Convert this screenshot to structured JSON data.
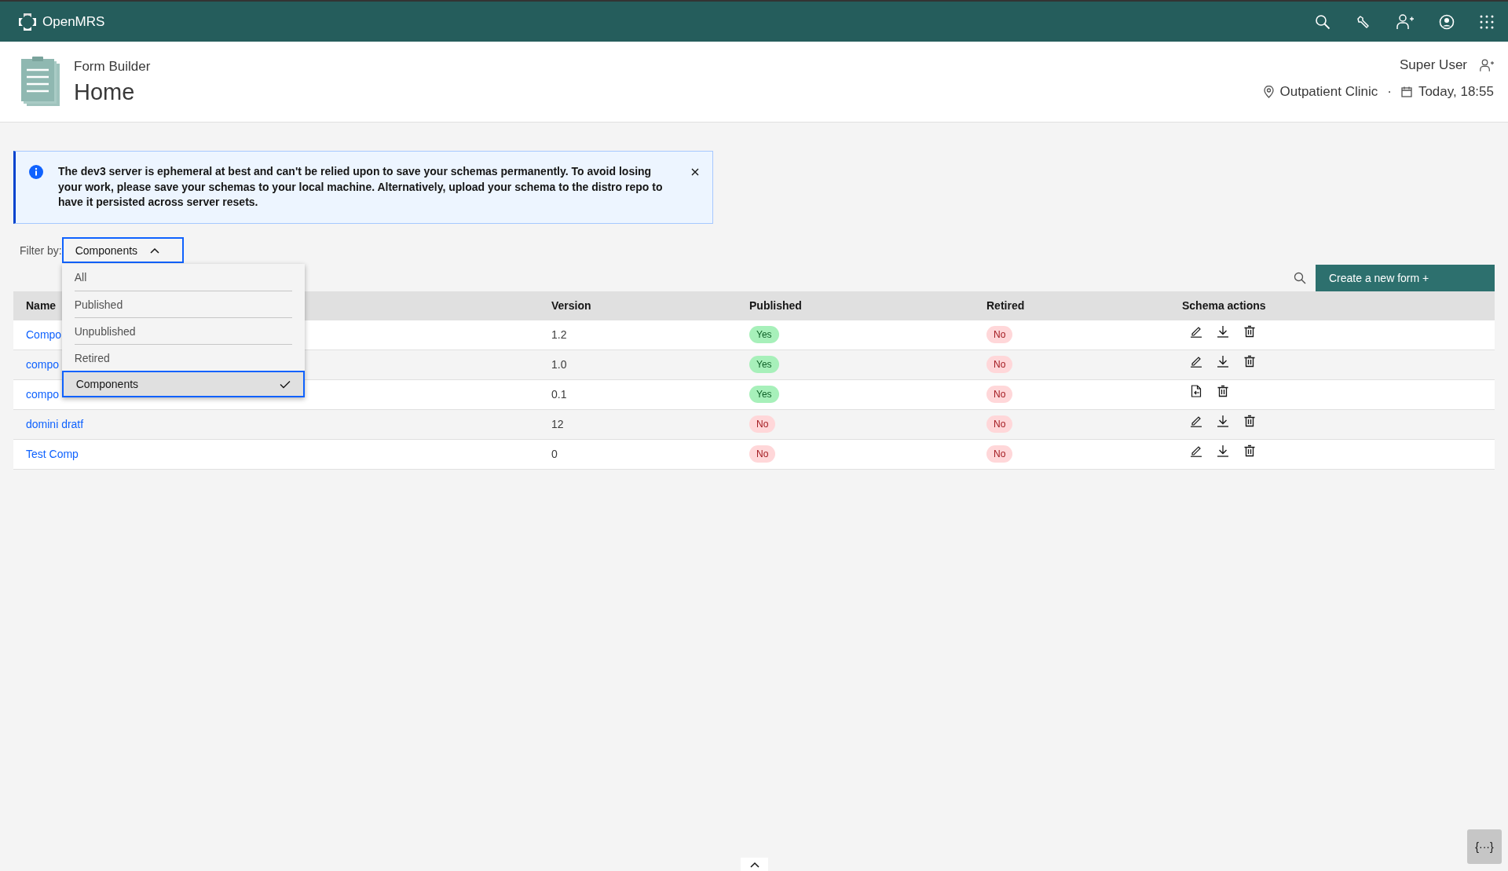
{
  "top_bar": {
    "brand": "OpenMRS"
  },
  "header": {
    "app": "Form Builder",
    "title": "Home",
    "user": "Super User",
    "location": "Outpatient Clinic",
    "separator": "·",
    "datetime": "Today, 18:55"
  },
  "notification": {
    "message": "The dev3 server is ephemeral at best and can't be relied upon to save your schemas permanently. To avoid losing your work, please save your schemas to your local machine. Alternatively, upload your schema to the distro repo to have it persisted across server resets."
  },
  "filter": {
    "label": "Filter by:",
    "value": "Components",
    "expanded": true,
    "options": [
      {
        "label": "All",
        "selected": false
      },
      {
        "label": "Published",
        "selected": false
      },
      {
        "label": "Unpublished",
        "selected": false
      },
      {
        "label": "Retired",
        "selected": false
      },
      {
        "label": "Components",
        "selected": true
      }
    ]
  },
  "create_button": "Create a new form +",
  "table": {
    "columns": [
      "Name",
      "Version",
      "Published",
      "Retired",
      "Schema actions"
    ],
    "rows": [
      {
        "name": "Compo",
        "version": "1.2",
        "published": {
          "label": "Yes",
          "color": "#a7f0ba"
        },
        "retired": {
          "label": "No",
          "color": "#ffd7d9"
        },
        "actions": [
          {
            "kind": "edit"
          },
          {
            "kind": "download"
          },
          {
            "kind": "delete"
          }
        ]
      },
      {
        "name": "compo",
        "version": "1.0",
        "published": {
          "label": "Yes",
          "color": "#a7f0ba"
        },
        "retired": {
          "label": "No",
          "color": "#ffd7d9"
        },
        "actions": [
          {
            "kind": "edit"
          },
          {
            "kind": "download"
          },
          {
            "kind": "delete"
          }
        ]
      },
      {
        "name": "compo",
        "version": "0.1",
        "published": {
          "label": "Yes",
          "color": "#a7f0ba"
        },
        "retired": {
          "label": "No",
          "color": "#ffd7d9"
        },
        "actions": [
          {
            "kind": "import"
          },
          {
            "kind": "delete"
          }
        ]
      },
      {
        "name": "domini dratf",
        "version": "12",
        "published": {
          "label": "No",
          "color": "#ffd7d9"
        },
        "retired": {
          "label": "No",
          "color": "#ffd7d9"
        },
        "actions": [
          {
            "kind": "edit"
          },
          {
            "kind": "download"
          },
          {
            "kind": "delete"
          }
        ]
      },
      {
        "name": "Test Comp",
        "version": "0",
        "published": {
          "label": "No",
          "color": "#ffd7d9"
        },
        "retired": {
          "label": "No",
          "color": "#ffd7d9"
        },
        "actions": [
          {
            "kind": "edit"
          },
          {
            "kind": "download"
          },
          {
            "kind": "delete"
          }
        ]
      }
    ]
  },
  "devtools_button": "{···}"
}
